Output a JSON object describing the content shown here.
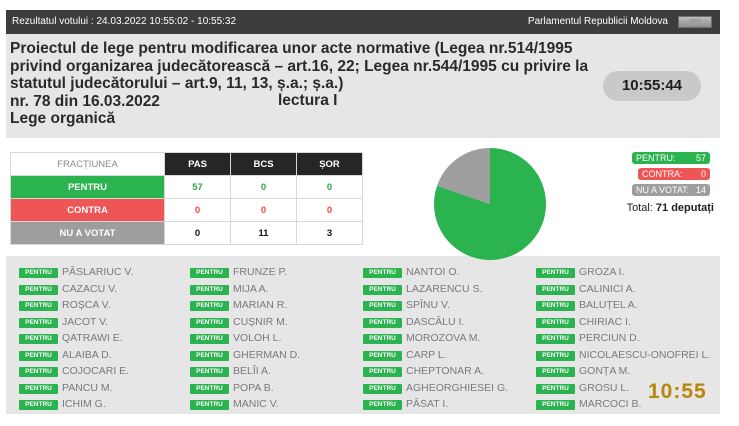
{
  "topbar": {
    "left": "Rezultatul votului : 24.03.2022 10:55:02 - 10:55:32",
    "right": "Parlamentul Republicii Moldova"
  },
  "title": {
    "line1": "Proiectul de lege pentru modificarea unor acte normative (Legea nr.514/1995",
    "line2": "privind organizarea judecătorească – art.16, 22; Legea nr.544/1995 cu privire la",
    "line3": "statutul judecătorului – art.9, 11, 13, ș.a.; ș.a.)",
    "line4": "nr. 78 din 16.03.2022",
    "lectura": "lectura I",
    "line5": "Lege organică"
  },
  "clock": "10:55:44",
  "table": {
    "header_fractiune": "FRACȚIUNEA",
    "factions": [
      "PAS",
      "BCS",
      "ȘOR"
    ],
    "rows": [
      {
        "label": "PENTRU",
        "values": [
          "57",
          "0",
          "0"
        ]
      },
      {
        "label": "CONTRA",
        "values": [
          "0",
          "0",
          "0"
        ]
      },
      {
        "label": "NU A VOTAT",
        "values": [
          "0",
          "11",
          "3"
        ]
      }
    ]
  },
  "chart_data": {
    "type": "pie",
    "categories": [
      "PENTRU",
      "CONTRA",
      "NU A VOTAT"
    ],
    "values": [
      57,
      0,
      14
    ],
    "colors": [
      "#2bb34f",
      "#ef5555",
      "#9e9e9e"
    ]
  },
  "legend": {
    "pentru_label": "PENTRU:",
    "pentru_value": "57",
    "contra_label": "CONTRA:",
    "contra_value": "0",
    "nuvot_label": "NU A VOTAT:",
    "nuvot_value": "14",
    "total_label": "Total:",
    "total_value": "71 deputați"
  },
  "deputies": {
    "tag": "PENTRU",
    "columns": [
      [
        "PÂSLARIUC V.",
        "CAZACU V.",
        "ROȘCA V.",
        "JACOT V.",
        "QATRAWI E.",
        "ALAIBA D.",
        "COJOCARI E.",
        "PANCU M.",
        "ICHIM G."
      ],
      [
        "FRUNZE P.",
        "MIJA A.",
        "MARIAN R.",
        "CUȘNIR M.",
        "VOLOH L.",
        "GHERMAN D.",
        "BELÎI A.",
        "POPA B.",
        "MANIC V."
      ],
      [
        "NANTOI O.",
        "LAZARENCU S.",
        "SPÎNU V.",
        "DASCĂLU I.",
        "MOROZOVA M.",
        "CARP L.",
        "CHEPTONAR A.",
        "AGHEORGHIESEI G.",
        "PÂSAT I."
      ],
      [
        "GROZA I.",
        "CALINICI A.",
        "BALUȚEL A.",
        "CHIRIAC I.",
        "PERCIUN D.",
        "NICOLAESCU-ONOFREI L.",
        "GONȚA M.",
        "GROSU L.",
        "MARCOCI B."
      ]
    ]
  },
  "minute_clock": "10:55"
}
